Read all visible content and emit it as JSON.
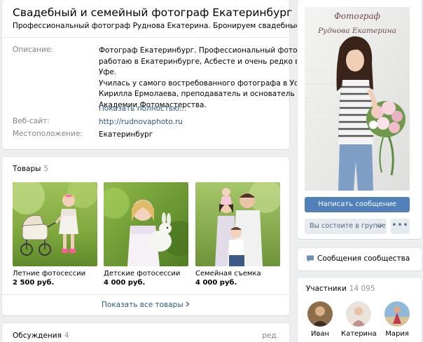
{
  "header": {
    "title": "Свадебный и семейный фотограф Екатеринбург",
    "status": "Профессиональный фотограф Руднова Екатерина. Бронируем свадебные даты !!!"
  },
  "info": {
    "description_label": "Описание:",
    "description_lines": [
      "Фотограф Екатеринбург. Профессиональный фотограф,",
      "работаю в Екатеринбурге, Асбесте и очень редко в г.",
      "Уфе.",
      "Училась у самого востребованного фотографа в Уфе -",
      "Кирилла Ермолаева, преподаватель и основатель",
      "Академии Фотомастерства."
    ],
    "show_more": "Показать полностью…",
    "website_label": "Веб-сайт:",
    "website_value": "http://rudnovaphoto.ru",
    "location_label": "Местоположение:",
    "location_value": "Екатеринбург"
  },
  "products": {
    "title": "Товары",
    "count": "5",
    "items": [
      {
        "name": "Летние фотосессии",
        "price": "2 500 руб."
      },
      {
        "name": "Детские фотосессии",
        "price": "4 000 руб."
      },
      {
        "name": "Семейная съемка",
        "price": "4 000 руб."
      }
    ],
    "show_all": "Показать все товары"
  },
  "discussions": {
    "title": "Обсуждения",
    "count": "4",
    "edit": "ред."
  },
  "cover": {
    "caption_line1": "Фотограф",
    "caption_line2": "Руднова Екатерина",
    "primary_button": "Написать сообщение",
    "group_button": "Вы состоите в группе",
    "more_button": "•••"
  },
  "messages": {
    "label": "Сообщения сообщества",
    "icon": "chat-bubble-icon"
  },
  "members": {
    "title": "Участники",
    "count": "14 095",
    "items": [
      {
        "name": "Иван"
      },
      {
        "name": "Катерина"
      },
      {
        "name": "Мария"
      }
    ]
  },
  "colors": {
    "background": "#edeef0",
    "link": "#2a5885",
    "primary_button": "#5181b8",
    "secondary_button": "#e5ebf1",
    "muted_text": "#828282"
  }
}
